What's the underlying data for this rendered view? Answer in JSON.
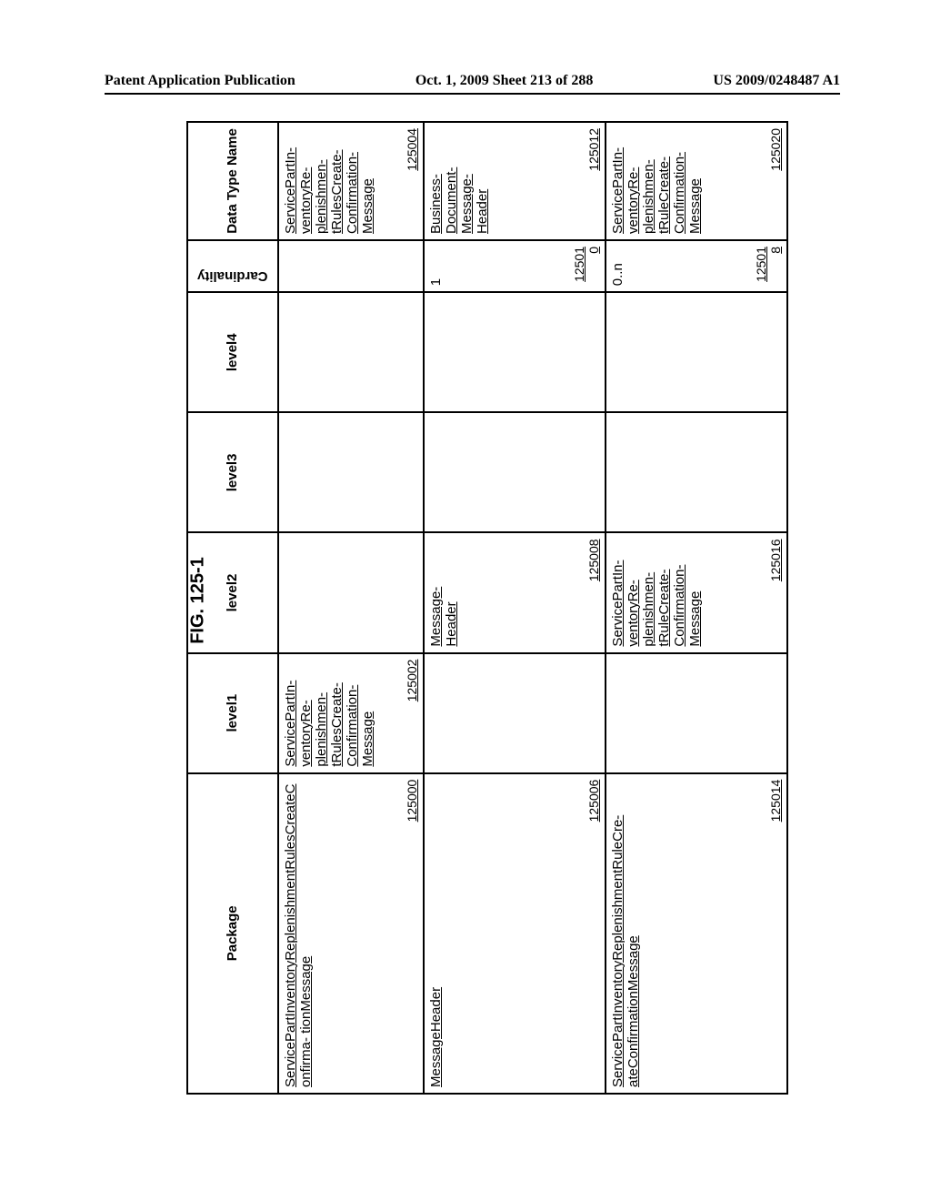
{
  "header": {
    "left": "Patent Application Publication",
    "mid": "Oct. 1, 2009  Sheet 213 of 288",
    "right": "US 2009/0248487 A1"
  },
  "figure_title": "FIG. 125-1",
  "columns": {
    "package": "Package",
    "level1": "level1",
    "level2": "level2",
    "level3": "level3",
    "level4": "level4",
    "cardinality": "Cardinality",
    "datatype": "Data Type Name"
  },
  "rows": [
    {
      "package": "ServicePartInventoryReplenishmentRulesCreateConfirma-\ntionMessage",
      "package_ref": "125000",
      "level1": "ServicePartIn-\nventoryRe-\nplenishmen-\ntRulesCreate-\nConfirmation-\nMessage",
      "level1_ref": "125002",
      "level2": "",
      "level2_ref": "",
      "level3": "",
      "level4": "",
      "cardinality": "",
      "datatype": "ServicePartIn-\nventoryRe-\nplenishmen-\ntRulesCreate-\nConfirmation-\nMessage",
      "datatype_ref": "125004"
    },
    {
      "package": "MessageHeader",
      "package_ref": "125006",
      "level1": "",
      "level1_ref": "",
      "level2": "Message-\nHeader",
      "level2_ref": "125008",
      "level3": "",
      "level4": "",
      "cardinality": "1",
      "cardinality_ref": "125010",
      "datatype": "Business-\nDocument-\nMessage-\nHeader",
      "datatype_ref": "125012"
    },
    {
      "package": "ServicePartInventoryReplenishmentRuleCre-\nateConfirmationMessage",
      "package_ref": "125014",
      "level1": "",
      "level1_ref": "",
      "level2": "ServicePartIn-\nventoryRe-\nplenishmen-\ntRuleCreate-\nConfirmation-\nMessage",
      "level2_ref": "125016",
      "level3": "",
      "level4": "",
      "cardinality": "0..n",
      "cardinality_ref": "125018",
      "datatype": "ServicePartIn-\nventoryRe-\nplenishmen-\ntRuleCreate-\nConfirmation-\nMessage",
      "datatype_ref": "125020"
    }
  ]
}
